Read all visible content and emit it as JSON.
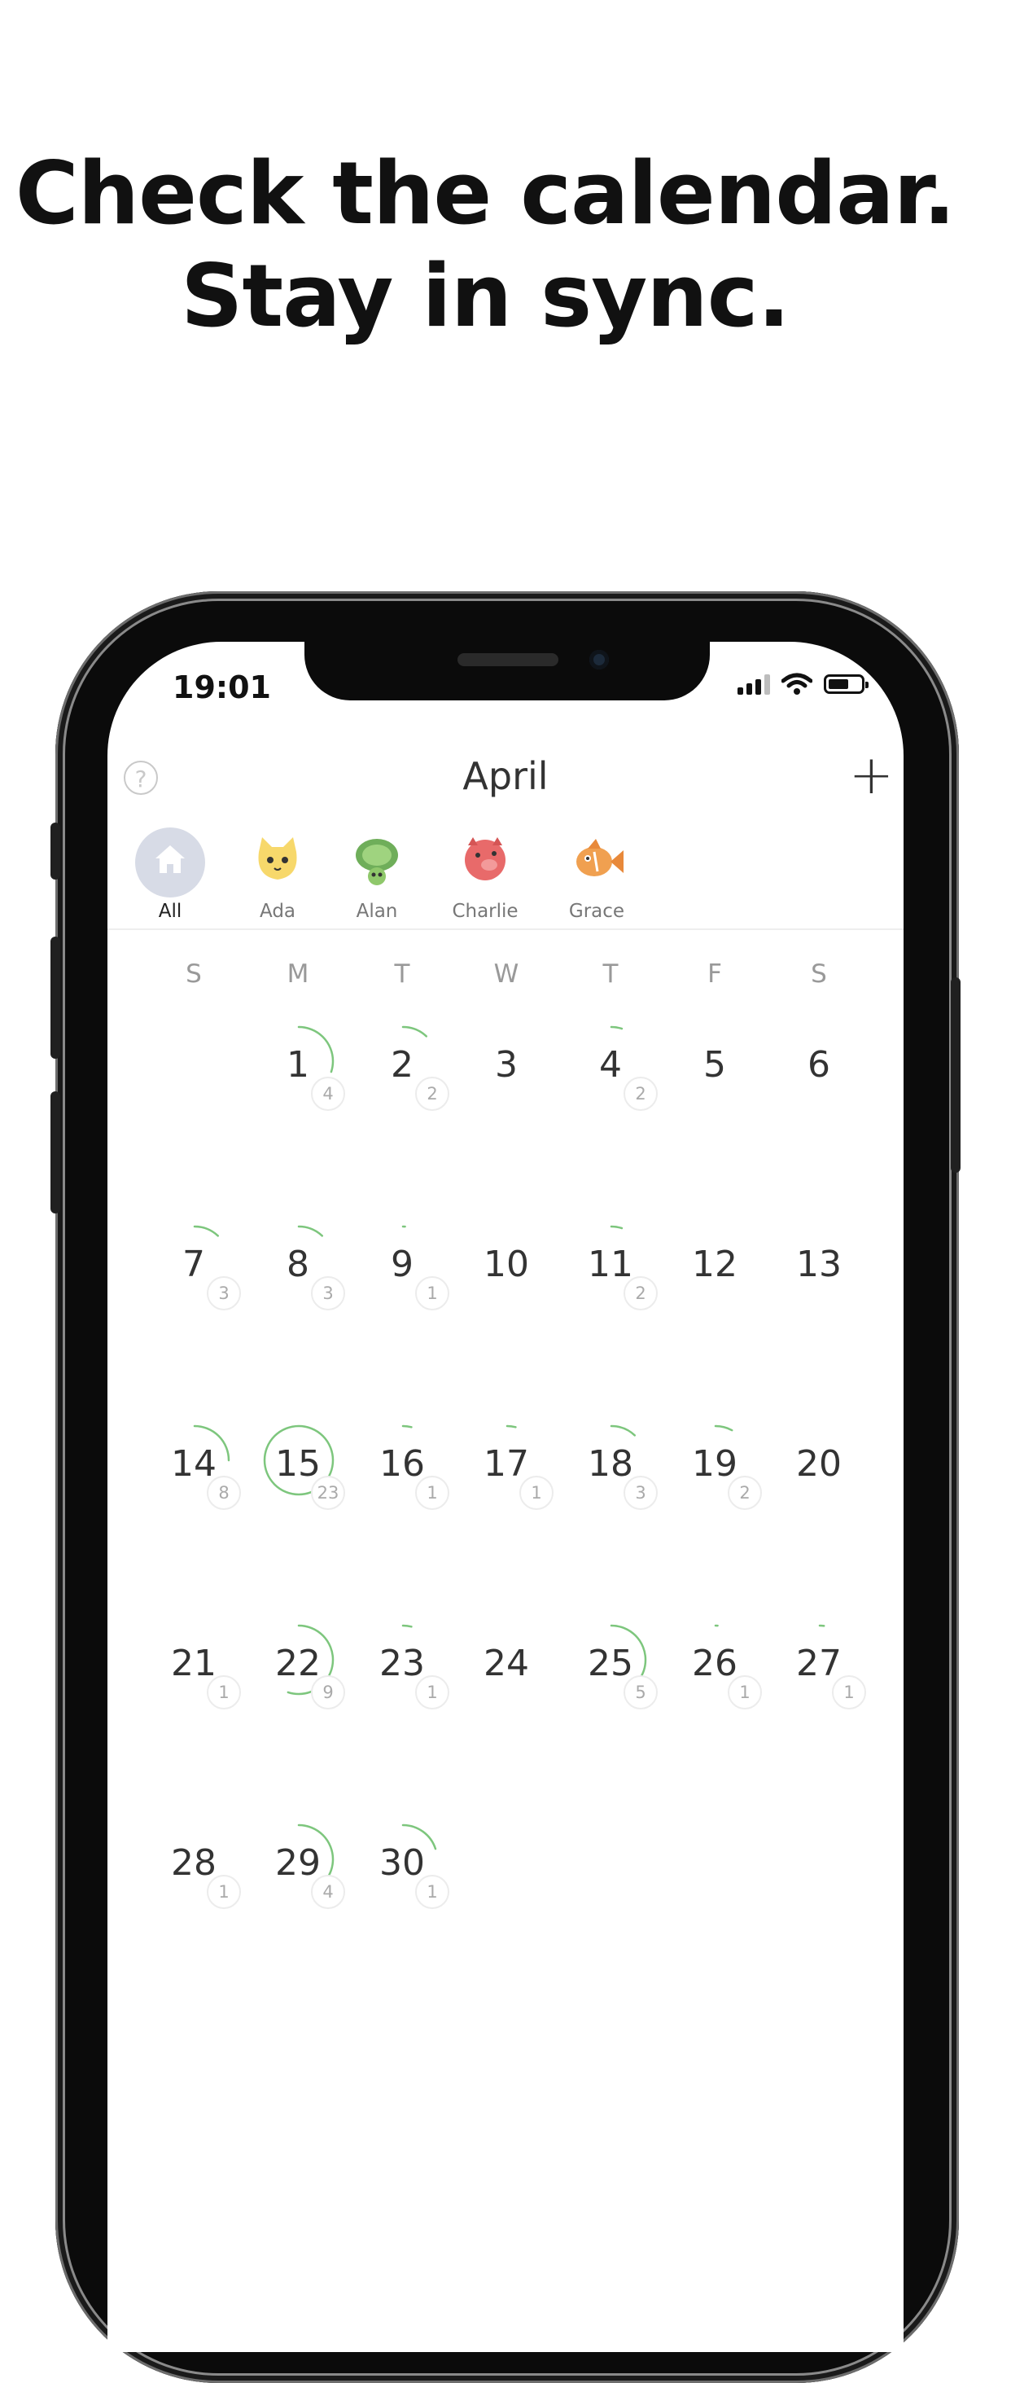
{
  "headline": {
    "line1": "Check the calendar.",
    "line2": "Stay in sync."
  },
  "status_bar": {
    "time": "19:01",
    "icons": [
      "cellular-signal-icon",
      "wifi-icon",
      "battery-icon"
    ]
  },
  "nav": {
    "help_icon": "?",
    "title": "April",
    "add_icon": "+"
  },
  "children": [
    {
      "name": "All",
      "icon": "house-icon",
      "selected": true
    },
    {
      "name": "Ada",
      "icon": "cat-icon",
      "color": "#f7d86b"
    },
    {
      "name": "Alan",
      "icon": "turtle-icon",
      "color": "#8fc86b"
    },
    {
      "name": "Charlie",
      "icon": "pig-icon",
      "color": "#e86a6a"
    },
    {
      "name": "Grace",
      "icon": "fish-icon",
      "color": "#f0a050"
    }
  ],
  "weekdays": [
    "S",
    "M",
    "T",
    "W",
    "T",
    "F",
    "S"
  ],
  "accent_color": "#7dc67d",
  "calendar": {
    "month": "April",
    "first_weekday_index": 1,
    "days": [
      {
        "day": "1",
        "count": "4",
        "progress": 0.3
      },
      {
        "day": "2",
        "count": "2",
        "progress": 0.12
      },
      {
        "day": "3",
        "count": "",
        "progress": 0
      },
      {
        "day": "4",
        "count": "2",
        "progress": 0.05
      },
      {
        "day": "5",
        "count": "",
        "progress": 0
      },
      {
        "day": "6",
        "count": "",
        "progress": 0
      },
      {
        "day": "7",
        "count": "3",
        "progress": 0.12
      },
      {
        "day": "8",
        "count": "3",
        "progress": 0.12
      },
      {
        "day": "9",
        "count": "1",
        "progress": 0.01
      },
      {
        "day": "10",
        "count": "",
        "progress": 0
      },
      {
        "day": "11",
        "count": "2",
        "progress": 0.05
      },
      {
        "day": "12",
        "count": "",
        "progress": 0
      },
      {
        "day": "13",
        "count": "",
        "progress": 0
      },
      {
        "day": "14",
        "count": "8",
        "progress": 0.25
      },
      {
        "day": "15",
        "count": "23",
        "progress": 1
      },
      {
        "day": "16",
        "count": "1",
        "progress": 0.04
      },
      {
        "day": "17",
        "count": "1",
        "progress": 0.04
      },
      {
        "day": "18",
        "count": "3",
        "progress": 0.12
      },
      {
        "day": "19",
        "count": "2",
        "progress": 0.08
      },
      {
        "day": "20",
        "count": "",
        "progress": 0
      },
      {
        "day": "21",
        "count": "1",
        "progress": 0
      },
      {
        "day": "22",
        "count": "9",
        "progress": 0.55
      },
      {
        "day": "23",
        "count": "1",
        "progress": 0.04
      },
      {
        "day": "24",
        "count": "",
        "progress": 0
      },
      {
        "day": "25",
        "count": "5",
        "progress": 0.35
      },
      {
        "day": "26",
        "count": "1",
        "progress": 0.01
      },
      {
        "day": "27",
        "count": "1",
        "progress": 0.02
      },
      {
        "day": "28",
        "count": "1",
        "progress": 0
      },
      {
        "day": "29",
        "count": "4",
        "progress": 0.38
      },
      {
        "day": "30",
        "count": "1",
        "progress": 0.2
      }
    ]
  }
}
